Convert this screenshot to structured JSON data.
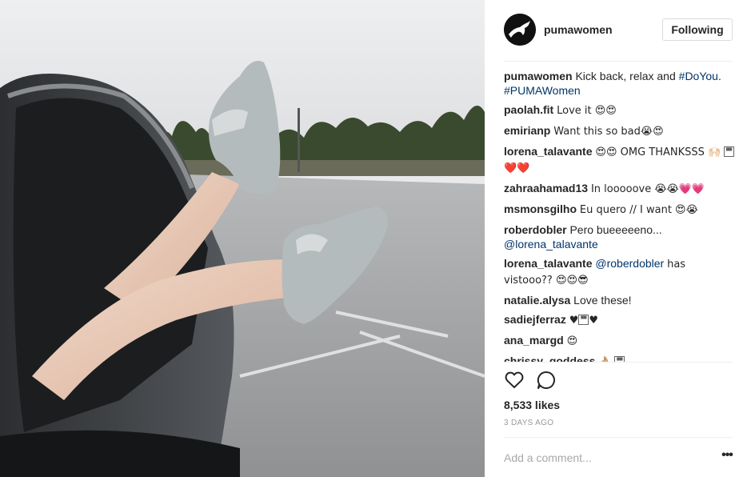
{
  "post": {
    "username": "pumawomen",
    "follow_label": "Following",
    "caption": {
      "user": "pumawomen",
      "text": "Kick back, relax and",
      "hashtags": "#DoYou. #PUMAWomen"
    },
    "comments": [
      {
        "user": "paolah.fit",
        "text": "Love it 😍😍"
      },
      {
        "user": "emirianp",
        "text": "Want this so bad😭😍"
      },
      {
        "user": "lorena_talavante",
        "text": "😍😍 OMG THANKSSS 🙌🏻",
        "tail": "❤️❤️"
      },
      {
        "user": "zahraahamad13",
        "text": "In looooove 😭😭💗💗"
      },
      {
        "user": "msmonsgilho",
        "text": "Eu quero // I want 😍😭"
      },
      {
        "user": "roberdobler",
        "text": "Pero bueeeeeno...",
        "mention": "@lorena_talavante"
      },
      {
        "user": "lorena_talavante",
        "mention": "@roberdobler",
        "text": "has vistooo?? 😍😍😎"
      },
      {
        "user": "natalie.alysa",
        "text": "Love these!"
      },
      {
        "user": "sadiejferraz",
        "text": "♥",
        "tail": "♥"
      },
      {
        "user": "ana_margd",
        "text": "😍"
      },
      {
        "user": "chrissy_goddess",
        "text": "👌🏼"
      }
    ],
    "likes": "8,533 likes",
    "age": "3 DAYS AGO",
    "add_comment_placeholder": "Add a comment...",
    "more_label": "•••",
    "icons": {
      "like": "heart-outline-icon",
      "comment": "speech-bubble-icon",
      "avatar": "puma-cat-logo"
    }
  }
}
